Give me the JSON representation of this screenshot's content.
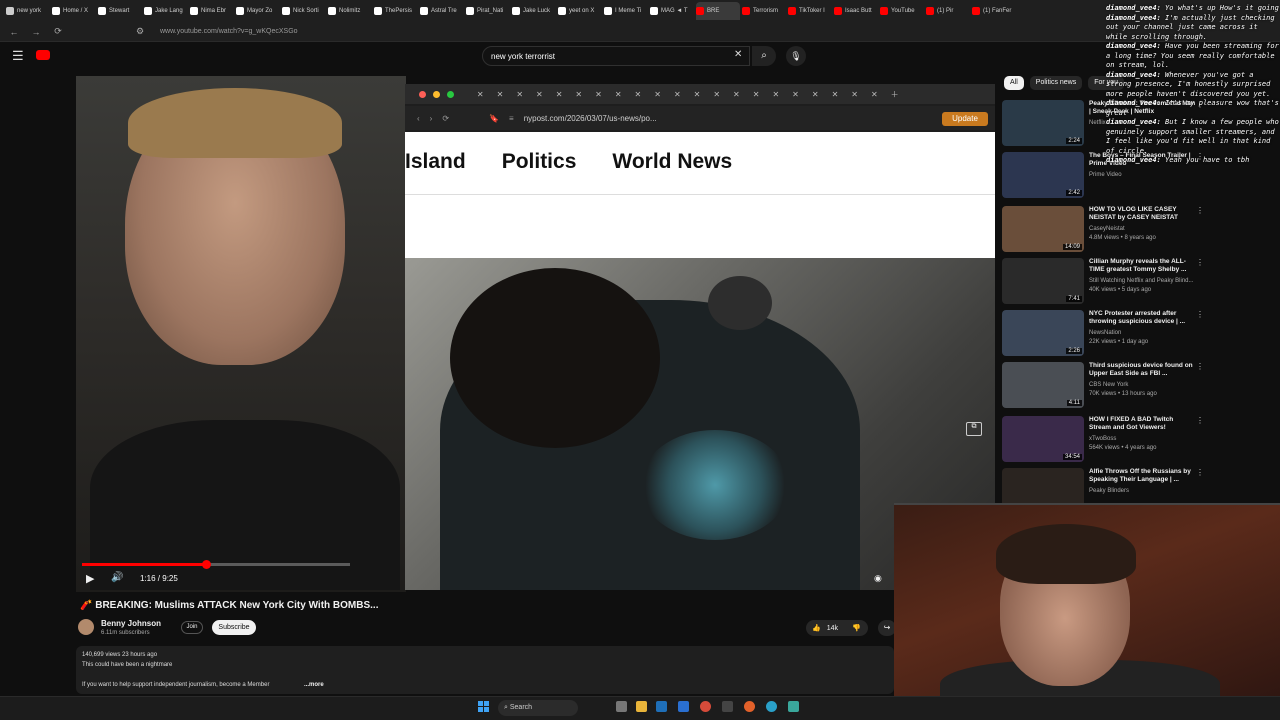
{
  "tabs": [
    {
      "label": "new york",
      "color": "#ccc"
    },
    {
      "label": "Home / X",
      "color": "#fff"
    },
    {
      "label": "Stewart",
      "color": "#fff"
    },
    {
      "label": "Jake Lang",
      "color": "#fff"
    },
    {
      "label": "Nima Ebr",
      "color": "#fff"
    },
    {
      "label": "Mayor Zo",
      "color": "#fff"
    },
    {
      "label": "Nick Sorti",
      "color": "#fff"
    },
    {
      "label": "Nolimitz",
      "color": "#fff"
    },
    {
      "label": "ThePersis",
      "color": "#fff"
    },
    {
      "label": "Astral Tre",
      "color": "#fff"
    },
    {
      "label": "Pirat_Nati",
      "color": "#fff"
    },
    {
      "label": "Jake Luck",
      "color": "#fff"
    },
    {
      "label": "yeet on X",
      "color": "#fff"
    },
    {
      "label": "I Meme Ti",
      "color": "#fff"
    },
    {
      "label": "MAG ◄ T",
      "color": "#fff"
    },
    {
      "label": "BRE",
      "color": "#f00"
    },
    {
      "label": "Terrorism",
      "color": "#f00"
    },
    {
      "label": "TikToker I",
      "color": "#f00"
    },
    {
      "label": "Isaac Butt",
      "color": "#f00"
    },
    {
      "label": "YouTube",
      "color": "#f00"
    },
    {
      "label": "(1) Pir",
      "color": "#f00"
    },
    {
      "label": "(1) FanFer",
      "color": "#f00"
    }
  ],
  "address": {
    "url": "www.youtube.com/watch?v=g_wKQecXSGo"
  },
  "search": {
    "query": "new york terrorrist"
  },
  "embedded": {
    "url": "nypost.com/2026/03/07/us-news/po...",
    "update_label": "Update",
    "nav": [
      "Island",
      "Politics",
      "World News"
    ]
  },
  "player": {
    "time": "1:16 / 9:25",
    "progress": 0.135
  },
  "video": {
    "title": "🧨 BREAKING: Muslims ATTACK New York City With BOMBS...",
    "channel": "Benny Johnson",
    "subscribers": "6.11m subscribers",
    "join": "Join",
    "subscribe": "Subscribe",
    "likes": "14k",
    "views": "140,699 views  23 hours ago",
    "desc1": "This could have been a nightmare",
    "desc2": "If you want to help support independent journalism, become a Member",
    "more": "...more"
  },
  "chips": [
    "All",
    "Politics news",
    "For you"
  ],
  "recs": [
    {
      "title": "Peaky Blinders: The Immortal Man | Sneak Peek | Netflix",
      "channel": "Netflix",
      "meta": "",
      "dur": "2:24",
      "color": "#2a3a48"
    },
    {
      "title": "The Boys – Final Season Trailer | Prime Video",
      "channel": "Prime Video",
      "meta": "",
      "dur": "2:42",
      "color": "#2c3650"
    },
    {
      "title": "HOW TO VLOG LIKE CASEY NEISTAT by CASEY NEISTAT",
      "channel": "CaseyNeistat",
      "meta": "4.8M views • 8 years ago",
      "dur": "14:09",
      "color": "#6a4e3a"
    },
    {
      "title": "Cillian Murphy reveals the ALL-TIME greatest Tommy Shelby ...",
      "channel": "Still Watching Netflix and Peaky Blind...",
      "meta": "40K views • 5 days ago",
      "dur": "7:41",
      "color": "#2a2a2a"
    },
    {
      "title": "NYC Protester arrested after throwing suspicious device | ...",
      "channel": "NewsNation",
      "meta": "22K views • 1 day ago",
      "dur": "2:26",
      "color": "#3a4658"
    },
    {
      "title": "Third suspicious device found on Upper East Side as FBI ...",
      "channel": "CBS New York",
      "meta": "70K views • 13 hours ago",
      "dur": "4:11",
      "color": "#4a4e54"
    },
    {
      "title": "HOW I FIXED A BAD Twitch Stream and Got Viewers!",
      "channel": "xTwoBoss",
      "meta": "564K views • 4 years ago",
      "dur": "34:54",
      "color": "#3a2a4a"
    },
    {
      "title": "Alfie Throws Off the Russians by Speaking Their Language | ...",
      "channel": "Peaky Blinders",
      "meta": "",
      "dur": "",
      "color": "#2a2420"
    }
  ],
  "chat": [
    {
      "user": "diamond_vee4:",
      "msg": "Yo what's up How's it going"
    },
    {
      "user": "diamond_vee4:",
      "msg": "I'm actually just checking out your channel just came across it while scrolling through."
    },
    {
      "user": "diamond_vee4:",
      "msg": "Have you been streaming for a long time? You seem really comfortable on stream, lol."
    },
    {
      "user": "diamond_vee4:",
      "msg": "Whenever you've got a strong presence, I'm honestly surprised more people haven't discovered you yet."
    },
    {
      "user": "diamond_vee4:",
      "msg": "It's my pleasure wow that's great"
    },
    {
      "user": "diamond_vee4:",
      "msg": "But I know a few people who genuinely support smaller streamers, and I feel like you'd fit well in that kind of circle."
    },
    {
      "user": "diamond_vee4:",
      "msg": "Yeah you have to tbh"
    }
  ],
  "taskbar": {
    "search": "Search"
  }
}
